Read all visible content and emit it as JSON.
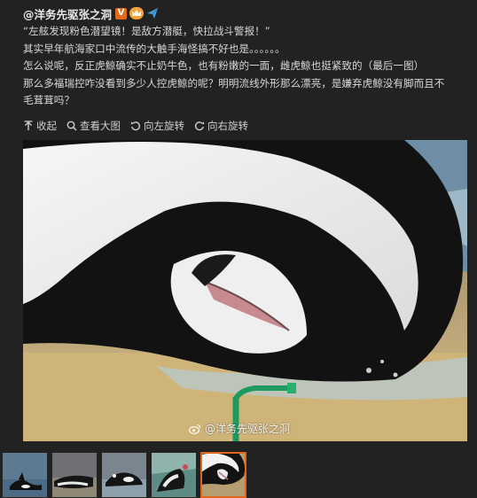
{
  "post": {
    "author": "@洋务先驱张之洞",
    "verified_badge": "V",
    "paragraphs": [
      "“左舷发现粉色潜望镜！是敌方潜艇，快拉战斗警报！”",
      "其实早年航海家口中流传的大触手海怪搞不好也是。。。。。。",
      "怎么说呢，反正虎鲸确实不止奶牛色，也有粉嫩的一面，雌虎鲸也挺紧致的（最后一图）",
      "那么多福瑞控咋没看到多少人控虎鲸的呢？明明流线外形那么漂亮，是嫌弃虎鲸没有脚而且不",
      "毛茸茸吗？"
    ]
  },
  "toolbar": {
    "collapse": "收起",
    "view_large": "查看大图",
    "rotate_left": "向左旋转",
    "rotate_right": "向右旋转"
  },
  "image": {
    "watermark": "@洋务先驱张之洞"
  },
  "thumbnails": [
    {
      "icon": "orca-water-thumbnail",
      "active": false
    },
    {
      "icon": "orca-beach-thumbnail",
      "active": false
    },
    {
      "icon": "orca-splash-thumbnail",
      "active": false
    },
    {
      "icon": "orca-pool-thumbnail",
      "active": false
    },
    {
      "icon": "orca-closeup-thumbnail",
      "active": true
    }
  ],
  "colors": {
    "background": "#222222",
    "active_thumb_border": "#e2651c",
    "verified_badge": "#e06a1e"
  }
}
